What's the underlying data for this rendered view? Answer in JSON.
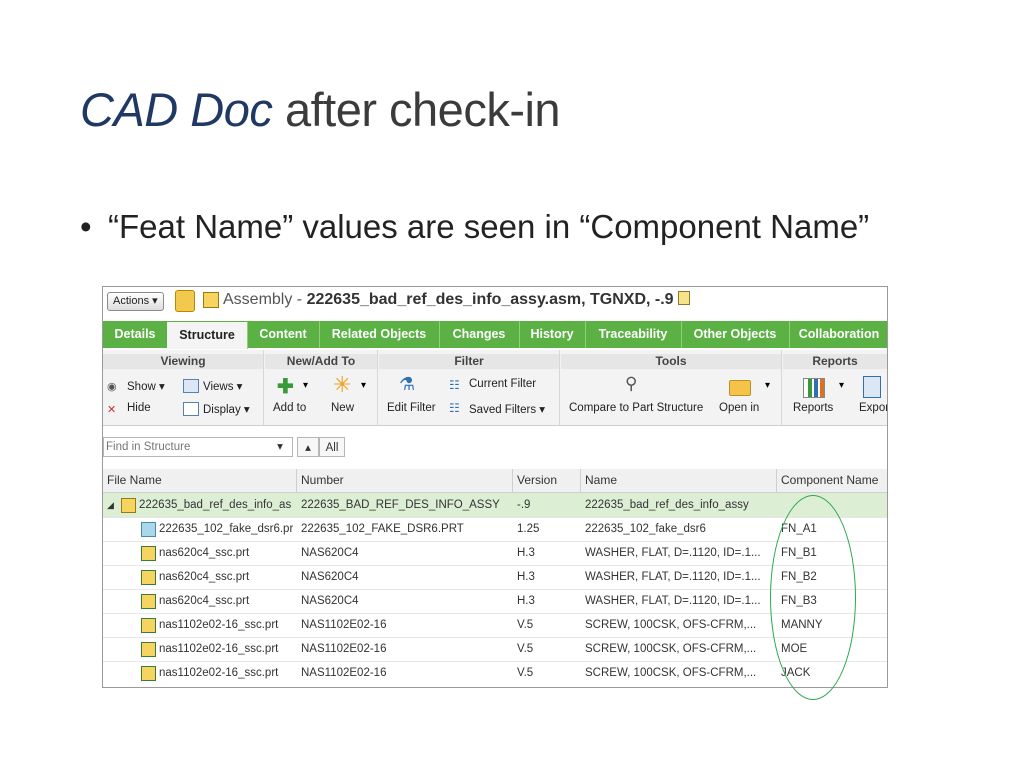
{
  "slide": {
    "title_em": "CAD Doc",
    "title_rest": "after check-in",
    "bullet": "“Feat Name” values are seen in “Component Name”"
  },
  "header": {
    "actions_label": "Actions ▾",
    "title_prefix": "Assembly -",
    "title_bold": "222635_bad_ref_des_info_assy.asm, TGNXD, -.9"
  },
  "tabs": [
    "Details",
    "Structure",
    "Content",
    "Related Objects",
    "Changes",
    "History",
    "Traceability",
    "Other Objects",
    "Collaboration"
  ],
  "ribbon": {
    "viewing": {
      "title": "Viewing",
      "show": "Show",
      "hide": "Hide",
      "views": "Views",
      "display": "Display"
    },
    "new_add": {
      "title": "New/Add To",
      "add_to": "Add to",
      "new": "New"
    },
    "filter": {
      "title": "Filter",
      "edit_filter": "Edit Filter",
      "current_filter": "Current Filter",
      "saved_filters": "Saved Filters"
    },
    "tools": {
      "title": "Tools",
      "compare": "Compare to Part Structure",
      "open_in": "Open in"
    },
    "reports": {
      "title": "Reports",
      "reports": "Reports",
      "export": "Expor"
    }
  },
  "find": {
    "placeholder": "Find in Structure",
    "all_label": "All"
  },
  "table": {
    "columns": [
      "File Name",
      "Number",
      "Version",
      "Name",
      "Component Name"
    ],
    "rows": [
      {
        "file": "222635_bad_ref_des_info_as",
        "number": "222635_BAD_REF_DES_INFO_ASSY",
        "version": "-.9",
        "name": "222635_bad_ref_des_info_assy",
        "component": ""
      },
      {
        "file": "222635_102_fake_dsr6.pr",
        "number": "222635_102_FAKE_DSR6.PRT",
        "version": "1.25",
        "name": "222635_102_fake_dsr6",
        "component": "FN_A1"
      },
      {
        "file": "nas620c4_ssc.prt",
        "number": "NAS620C4",
        "version": "H.3",
        "name": "WASHER, FLAT, D=.1120, ID=.1...",
        "component": "FN_B1"
      },
      {
        "file": "nas620c4_ssc.prt",
        "number": "NAS620C4",
        "version": "H.3",
        "name": "WASHER, FLAT, D=.1120, ID=.1...",
        "component": "FN_B2"
      },
      {
        "file": "nas620c4_ssc.prt",
        "number": "NAS620C4",
        "version": "H.3",
        "name": "WASHER, FLAT, D=.1120, ID=.1...",
        "component": "FN_B3"
      },
      {
        "file": "nas1102e02-16_ssc.prt",
        "number": "NAS1102E02-16",
        "version": "V.5",
        "name": "SCREW, 100CSK, OFS-CFRM,...",
        "component": "MANNY"
      },
      {
        "file": "nas1102e02-16_ssc.prt",
        "number": "NAS1102E02-16",
        "version": "V.5",
        "name": "SCREW, 100CSK, OFS-CFRM,...",
        "component": "MOE"
      },
      {
        "file": "nas1102e02-16_ssc.prt",
        "number": "NAS1102E02-16",
        "version": "V.5",
        "name": "SCREW, 100CSK, OFS-CFRM,...",
        "component": "JACK"
      }
    ]
  },
  "colors": {
    "tab_green": "#5cb145",
    "title_blue": "#1f3864",
    "annotation_green": "#2aa84f"
  }
}
